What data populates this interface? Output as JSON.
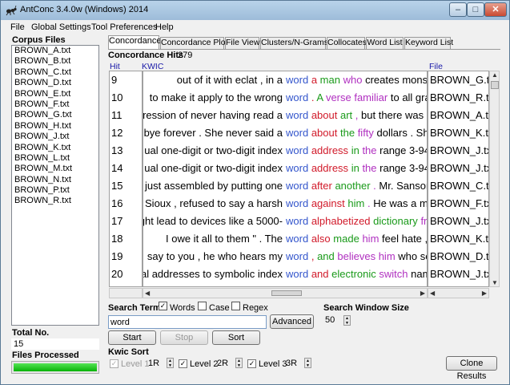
{
  "window": {
    "title": "AntConc 3.4.0w (Windows) 2014",
    "controls": [
      "–",
      "□",
      "✕"
    ]
  },
  "menu": [
    "File",
    "Global Settings",
    "Tool Preferences",
    "Help"
  ],
  "corpus": {
    "label": "Corpus Files",
    "files": [
      "BROWN_A.txt",
      "BROWN_B.txt",
      "BROWN_C.txt",
      "BROWN_D.txt",
      "BROWN_E.txt",
      "BROWN_F.txt",
      "BROWN_G.txt",
      "BROWN_H.txt",
      "BROWN_J.txt",
      "BROWN_K.txt",
      "BROWN_L.txt",
      "BROWN_M.txt",
      "BROWN_N.txt",
      "BROWN_P.txt",
      "BROWN_R.txt"
    ],
    "total_label": "Total No.",
    "total_value": "15",
    "processed_label": "Files Processed",
    "processed_progress": 1.0
  },
  "tabs": [
    "Concordance",
    "Concordance Plot",
    "File View",
    "Clusters/N-Grams",
    "Collocates",
    "Word List",
    "Keyword List"
  ],
  "concordance": {
    "hits_label": "Concordance Hits",
    "hits_count": "279",
    "col_hit": "Hit",
    "col_kwic": "KWIC",
    "col_file": "File",
    "rows": [
      {
        "hit": "9",
        "left": "out of it with eclat , in a",
        "kw": "word",
        "r1": "a",
        "r2": "man",
        "r3": "who",
        "rest": "creates monste",
        "file": "BROWN_G.txt"
      },
      {
        "hit": "10",
        "left": "to make it apply to the wrong",
        "kw": "word",
        "r1": ".",
        "r2": "A",
        "r3": "verse familiar",
        "rest": "to all gra",
        "file": "BROWN_R.txt"
      },
      {
        "hit": "11",
        "left": "pression of never having read a",
        "kw": "word",
        "r1": "about",
        "r2": "art",
        "r3": ",",
        "rest": "but there was n",
        "file": "BROWN_A.txt"
      },
      {
        "hit": "12",
        "left": "odbye forever . She never said a",
        "kw": "word",
        "r1": "about",
        "r2": "the",
        "r3": "fifty",
        "rest": "dollars . She",
        "file": "BROWN_K.txt"
      },
      {
        "hit": "13",
        "left": "ual one-digit or two-digit index",
        "kw": "word",
        "r1": "address",
        "r2": "in",
        "r3": "the",
        "rest": "range 3-94",
        "file": "BROWN_J.txt"
      },
      {
        "hit": "14",
        "left": "ual one-digit or two-digit index",
        "kw": "word",
        "r1": "address",
        "r2": "in",
        "r3": "the",
        "rest": "range 3-94",
        "file": "BROWN_J.txt"
      },
      {
        "hit": "15",
        "left": "e just assembled by putting one",
        "kw": "word",
        "r1": "after",
        "r2": "another",
        "r3": ".",
        "rest": "Mr. Sansom",
        "file": "BROWN_C.txt"
      },
      {
        "hit": "16",
        "left": "he Sioux , refused to say a harsh",
        "kw": "word",
        "r1": "against",
        "r2": "him",
        "r3": ".",
        "rest": "He was a me",
        "file": "BROWN_F.txt"
      },
      {
        "hit": "17",
        "left": "ight lead to devices like a 5000-",
        "kw": "word",
        "r1": "alphabetized",
        "r2": "dictionary",
        "r3": "fro",
        "rest": "",
        "file": "BROWN_J.txt"
      },
      {
        "hit": "18",
        "left": "I owe it all to them \" . The",
        "kw": "word",
        "r1": "also",
        "r2": "made",
        "r3": "him",
        "rest": "feel hate , s",
        "file": "BROWN_K.txt"
      },
      {
        "hit": "19",
        "left": "say to you , he who hears my",
        "kw": "word",
        "r1": ",",
        "r2": "and",
        "r3": "believes him",
        "rest": "who se",
        "file": "BROWN_D.txt"
      },
      {
        "hit": "20",
        "left": "ual addresses to symbolic index",
        "kw": "word",
        "r1": "and",
        "r2": "electronic",
        "r3": "switch",
        "rest": "nam",
        "file": "BROWN_J.txt"
      },
      {
        "hit": "21",
        "left": "nglish sentence and the Martian",
        "kw": "word",
        "r1": "and",
        "r2": "felt",
        "r3": "closer",
        "rest": "grokking . F",
        "file": "BROWN_M.txt"
      },
      {
        "hit": "22",
        "left": "bruise our satisfactions with his",
        "kw": "word",
        "r1": ",",
        "r2": "and",
        "r3": "God",
        "rest": "'s . We do not de",
        "file": "BROWN_B.txt"
      }
    ]
  },
  "search": {
    "term_label": "Search Term",
    "words_label": "Words",
    "words_checked": true,
    "case_label": "Case",
    "case_checked": false,
    "regex_label": "Regex",
    "regex_checked": false,
    "term_value": "word",
    "advanced_label": "Advanced",
    "start_label": "Start",
    "stop_label": "Stop",
    "sort_label": "Sort",
    "window_size_label": "Search Window Size",
    "window_size_value": "50"
  },
  "kwic_sort": {
    "label": "Kwic Sort",
    "level1_label": "Level 1",
    "level1_value": "1R",
    "level2_label": "Level 2",
    "level2_value": "2R",
    "level3_label": "Level 3",
    "level3_value": "3R",
    "clone_label": "Clone Results"
  }
}
